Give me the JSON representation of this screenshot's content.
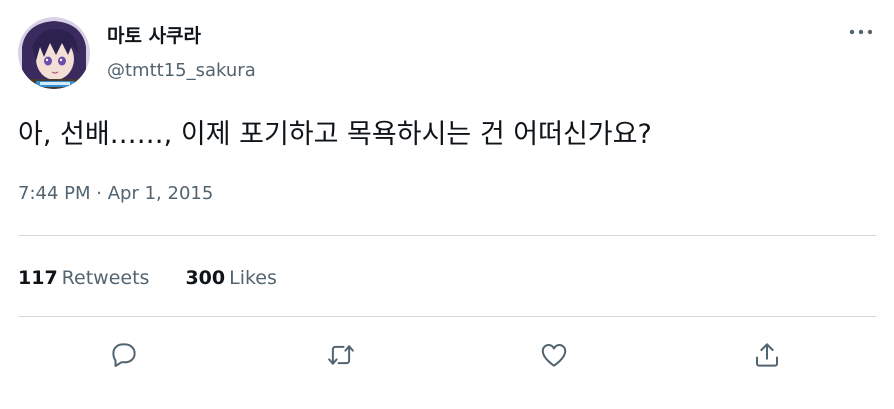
{
  "tweet": {
    "display_name": "마토 사쿠라",
    "handle": "@tmtt15_sakura",
    "text": "아, 선배……, 이제 포기하고 목욕하시는 건 어떠신가요?",
    "time": "7:44 PM",
    "separator": "·",
    "date": "Apr 1, 2015"
  },
  "stats": {
    "retweets_count": "117",
    "retweets_label": "Retweets",
    "likes_count": "300",
    "likes_label": "Likes"
  },
  "colors": {
    "text": "#0f1419",
    "secondary": "#536471",
    "divider": "#cfd9de",
    "icon": "#536471"
  },
  "icons": {
    "more": "more-icon",
    "reply": "reply-icon",
    "retweet": "retweet-icon",
    "like": "like-icon",
    "share": "share-icon"
  }
}
